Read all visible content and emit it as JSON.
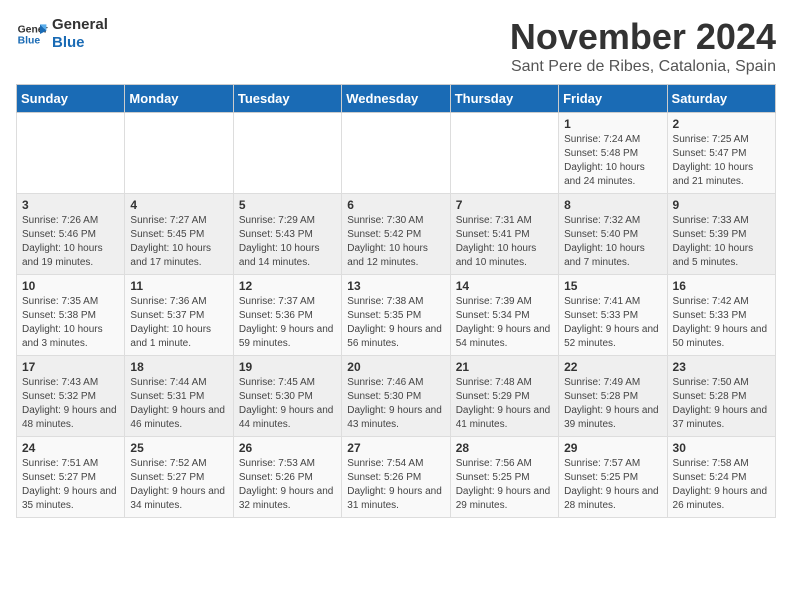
{
  "logo": {
    "line1": "General",
    "line2": "Blue"
  },
  "header": {
    "month": "November 2024",
    "location": "Sant Pere de Ribes, Catalonia, Spain"
  },
  "weekdays": [
    "Sunday",
    "Monday",
    "Tuesday",
    "Wednesday",
    "Thursday",
    "Friday",
    "Saturday"
  ],
  "weeks": [
    [
      {
        "day": "",
        "info": ""
      },
      {
        "day": "",
        "info": ""
      },
      {
        "day": "",
        "info": ""
      },
      {
        "day": "",
        "info": ""
      },
      {
        "day": "",
        "info": ""
      },
      {
        "day": "1",
        "info": "Sunrise: 7:24 AM\nSunset: 5:48 PM\nDaylight: 10 hours and 24 minutes."
      },
      {
        "day": "2",
        "info": "Sunrise: 7:25 AM\nSunset: 5:47 PM\nDaylight: 10 hours and 21 minutes."
      }
    ],
    [
      {
        "day": "3",
        "info": "Sunrise: 7:26 AM\nSunset: 5:46 PM\nDaylight: 10 hours and 19 minutes."
      },
      {
        "day": "4",
        "info": "Sunrise: 7:27 AM\nSunset: 5:45 PM\nDaylight: 10 hours and 17 minutes."
      },
      {
        "day": "5",
        "info": "Sunrise: 7:29 AM\nSunset: 5:43 PM\nDaylight: 10 hours and 14 minutes."
      },
      {
        "day": "6",
        "info": "Sunrise: 7:30 AM\nSunset: 5:42 PM\nDaylight: 10 hours and 12 minutes."
      },
      {
        "day": "7",
        "info": "Sunrise: 7:31 AM\nSunset: 5:41 PM\nDaylight: 10 hours and 10 minutes."
      },
      {
        "day": "8",
        "info": "Sunrise: 7:32 AM\nSunset: 5:40 PM\nDaylight: 10 hours and 7 minutes."
      },
      {
        "day": "9",
        "info": "Sunrise: 7:33 AM\nSunset: 5:39 PM\nDaylight: 10 hours and 5 minutes."
      }
    ],
    [
      {
        "day": "10",
        "info": "Sunrise: 7:35 AM\nSunset: 5:38 PM\nDaylight: 10 hours and 3 minutes."
      },
      {
        "day": "11",
        "info": "Sunrise: 7:36 AM\nSunset: 5:37 PM\nDaylight: 10 hours and 1 minute."
      },
      {
        "day": "12",
        "info": "Sunrise: 7:37 AM\nSunset: 5:36 PM\nDaylight: 9 hours and 59 minutes."
      },
      {
        "day": "13",
        "info": "Sunrise: 7:38 AM\nSunset: 5:35 PM\nDaylight: 9 hours and 56 minutes."
      },
      {
        "day": "14",
        "info": "Sunrise: 7:39 AM\nSunset: 5:34 PM\nDaylight: 9 hours and 54 minutes."
      },
      {
        "day": "15",
        "info": "Sunrise: 7:41 AM\nSunset: 5:33 PM\nDaylight: 9 hours and 52 minutes."
      },
      {
        "day": "16",
        "info": "Sunrise: 7:42 AM\nSunset: 5:33 PM\nDaylight: 9 hours and 50 minutes."
      }
    ],
    [
      {
        "day": "17",
        "info": "Sunrise: 7:43 AM\nSunset: 5:32 PM\nDaylight: 9 hours and 48 minutes."
      },
      {
        "day": "18",
        "info": "Sunrise: 7:44 AM\nSunset: 5:31 PM\nDaylight: 9 hours and 46 minutes."
      },
      {
        "day": "19",
        "info": "Sunrise: 7:45 AM\nSunset: 5:30 PM\nDaylight: 9 hours and 44 minutes."
      },
      {
        "day": "20",
        "info": "Sunrise: 7:46 AM\nSunset: 5:30 PM\nDaylight: 9 hours and 43 minutes."
      },
      {
        "day": "21",
        "info": "Sunrise: 7:48 AM\nSunset: 5:29 PM\nDaylight: 9 hours and 41 minutes."
      },
      {
        "day": "22",
        "info": "Sunrise: 7:49 AM\nSunset: 5:28 PM\nDaylight: 9 hours and 39 minutes."
      },
      {
        "day": "23",
        "info": "Sunrise: 7:50 AM\nSunset: 5:28 PM\nDaylight: 9 hours and 37 minutes."
      }
    ],
    [
      {
        "day": "24",
        "info": "Sunrise: 7:51 AM\nSunset: 5:27 PM\nDaylight: 9 hours and 35 minutes."
      },
      {
        "day": "25",
        "info": "Sunrise: 7:52 AM\nSunset: 5:27 PM\nDaylight: 9 hours and 34 minutes."
      },
      {
        "day": "26",
        "info": "Sunrise: 7:53 AM\nSunset: 5:26 PM\nDaylight: 9 hours and 32 minutes."
      },
      {
        "day": "27",
        "info": "Sunrise: 7:54 AM\nSunset: 5:26 PM\nDaylight: 9 hours and 31 minutes."
      },
      {
        "day": "28",
        "info": "Sunrise: 7:56 AM\nSunset: 5:25 PM\nDaylight: 9 hours and 29 minutes."
      },
      {
        "day": "29",
        "info": "Sunrise: 7:57 AM\nSunset: 5:25 PM\nDaylight: 9 hours and 28 minutes."
      },
      {
        "day": "30",
        "info": "Sunrise: 7:58 AM\nSunset: 5:24 PM\nDaylight: 9 hours and 26 minutes."
      }
    ]
  ]
}
